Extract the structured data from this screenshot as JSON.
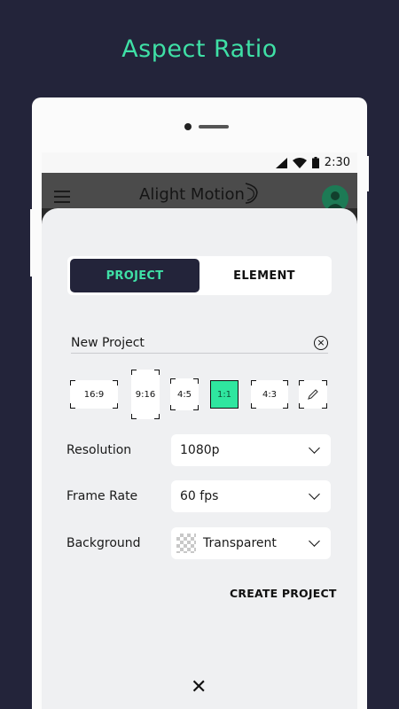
{
  "promo": {
    "title": "Aspect Ratio"
  },
  "statusbar": {
    "time": "2:30",
    "icons": [
      "signal-icon",
      "wifi-icon",
      "battery-icon"
    ]
  },
  "appbar": {
    "title": "Alight Motion",
    "menu_icon": "menu-icon",
    "avatar_icon": "avatar-icon"
  },
  "tabs": [
    {
      "label": "PROJECT",
      "active": true
    },
    {
      "label": "ELEMENT",
      "active": false
    }
  ],
  "project_name": {
    "value": "New Project"
  },
  "aspect_ratios": [
    {
      "label": "16:9",
      "selected": false
    },
    {
      "label": "9:16",
      "selected": false
    },
    {
      "label": "4:5",
      "selected": false
    },
    {
      "label": "1:1",
      "selected": true
    },
    {
      "label": "4:3",
      "selected": false
    },
    {
      "label": "",
      "icon": "pencil-icon",
      "selected": false
    }
  ],
  "form": {
    "resolution": {
      "label": "Resolution",
      "value": "1080p"
    },
    "frame_rate": {
      "label": "Frame Rate",
      "value": "60 fps"
    },
    "background": {
      "label": "Background",
      "value": "Transparent"
    }
  },
  "actions": {
    "create": "CREATE PROJECT",
    "close_icon": "close-icon"
  },
  "colors": {
    "accent": "#3fe0a6",
    "dark": "#23243a",
    "selected_ratio": "#2fe69f"
  }
}
